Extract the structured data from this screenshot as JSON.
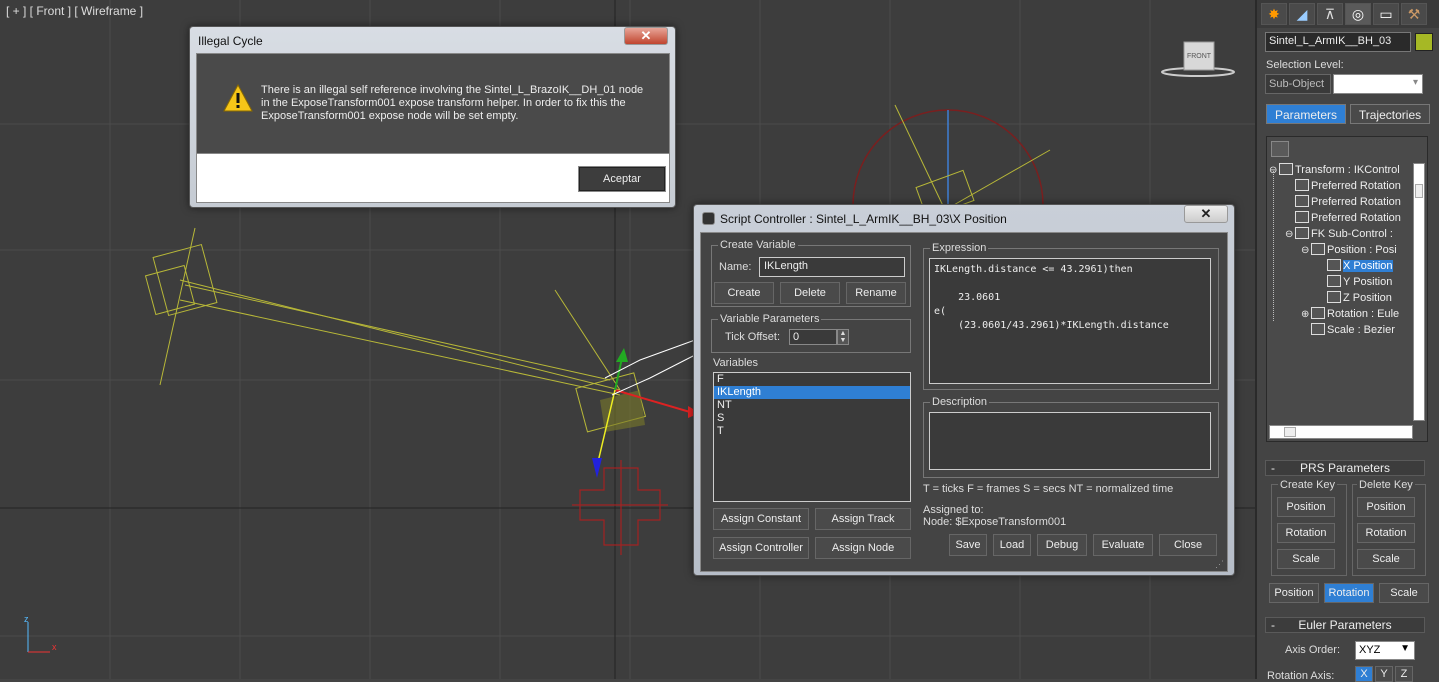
{
  "viewport": {
    "label": "[ + ] [ Front ] [ Wireframe ]",
    "viewcube_label": "FRONT",
    "gizmo_axes": {
      "x": "x",
      "y": "y",
      "z": "z"
    }
  },
  "cmd_panel": {
    "tabs": [
      "create-icon",
      "modify-icon",
      "hierarchy-icon",
      "motion-icon",
      "display-icon",
      "utilities-icon"
    ],
    "object_name": "Sintel_L_ArmIK__BH_03",
    "object_color": "#a6b825",
    "selection_level_label": "Selection Level:",
    "sub_object_label": "Sub-Object",
    "tab_parameters": "Parameters",
    "tab_trajectories": "Trajectories",
    "tree": [
      {
        "label": "Transform : IKControl",
        "indent": 0,
        "expander": "⊖"
      },
      {
        "label": "Preferred Rotation",
        "indent": 1,
        "expander": ""
      },
      {
        "label": "Preferred Rotation",
        "indent": 1,
        "expander": ""
      },
      {
        "label": "Preferred Rotation",
        "indent": 1,
        "expander": ""
      },
      {
        "label": "FK Sub-Control : ",
        "indent": 1,
        "expander": "⊖"
      },
      {
        "label": "Position : Posi",
        "indent": 2,
        "expander": "⊖"
      },
      {
        "label": "X Position",
        "indent": 3,
        "expander": "",
        "selected": true
      },
      {
        "label": "Y Position",
        "indent": 3,
        "expander": ""
      },
      {
        "label": "Z Position",
        "indent": 3,
        "expander": ""
      },
      {
        "label": "Rotation : Eule",
        "indent": 2,
        "expander": "⊕"
      },
      {
        "label": "Scale : Bezier",
        "indent": 2,
        "expander": ""
      }
    ],
    "prs": {
      "title": "PRS Parameters",
      "create_key_label": "Create Key",
      "delete_key_label": "Delete Key",
      "create_position": "Position",
      "create_rotation": "Rotation",
      "create_scale": "Scale",
      "delete_position": "Position",
      "delete_rotation": "Rotation",
      "delete_scale": "Scale",
      "mode_position": "Position",
      "mode_rotation": "Rotation",
      "mode_scale": "Scale"
    },
    "euler": {
      "title": "Euler Parameters",
      "axis_order_label": "Axis Order:",
      "axis_order_value": "XYZ",
      "rotation_axis_label": "Rotation Axis:",
      "axis_x": "X",
      "axis_y": "Y",
      "axis_z": "Z"
    },
    "accent_color": "#2f7fd4"
  },
  "illegal_dialog": {
    "title": "Illegal Cycle",
    "message_1": "There is an illegal self reference involving the Sintel_L_BrazoIK__DH_01 node",
    "message_2": "in the ExposeTransform001 expose transform helper.  In order to fix this the",
    "message_3": "ExposeTransform001 expose node will be set empty.",
    "ok_label": "Aceptar",
    "close_label": "✕"
  },
  "script_dialog": {
    "title": "Script Controller : Sintel_L_ArmIK__BH_03\\X Position",
    "close_label": "✕",
    "create_variable_label": "Create Variable",
    "name_label": "Name:",
    "name_value": "IKLength",
    "create_label": "Create",
    "delete_label": "Delete",
    "rename_label": "Rename",
    "var_params_label": "Variable Parameters",
    "tick_offset_label": "Tick Offset:",
    "tick_offset_value": "0",
    "variables_label": "Variables",
    "variables": [
      "F",
      "IKLength",
      "NT",
      "S",
      "T"
    ],
    "selected_variable": "IKLength",
    "assign_constant": "Assign Constant",
    "assign_track": "Assign Track",
    "assign_controller": "Assign Controller",
    "assign_node": "Assign Node",
    "expression_label": "Expression",
    "expression_text": "IKLength.distance <= 43.2961)then\n\n    23.0601\ne(\n    (23.0601/43.2961)*IKLength.distance",
    "description_label": "Description",
    "legend": "T = ticks     F = frames     S = secs     NT = normalized time",
    "assigned_to_label": "Assigned to:",
    "assigned_to_value": "Node: $ExposeTransform001",
    "save": "Save",
    "load": "Load",
    "debug": "Debug",
    "evaluate": "Evaluate",
    "close": "Close"
  }
}
